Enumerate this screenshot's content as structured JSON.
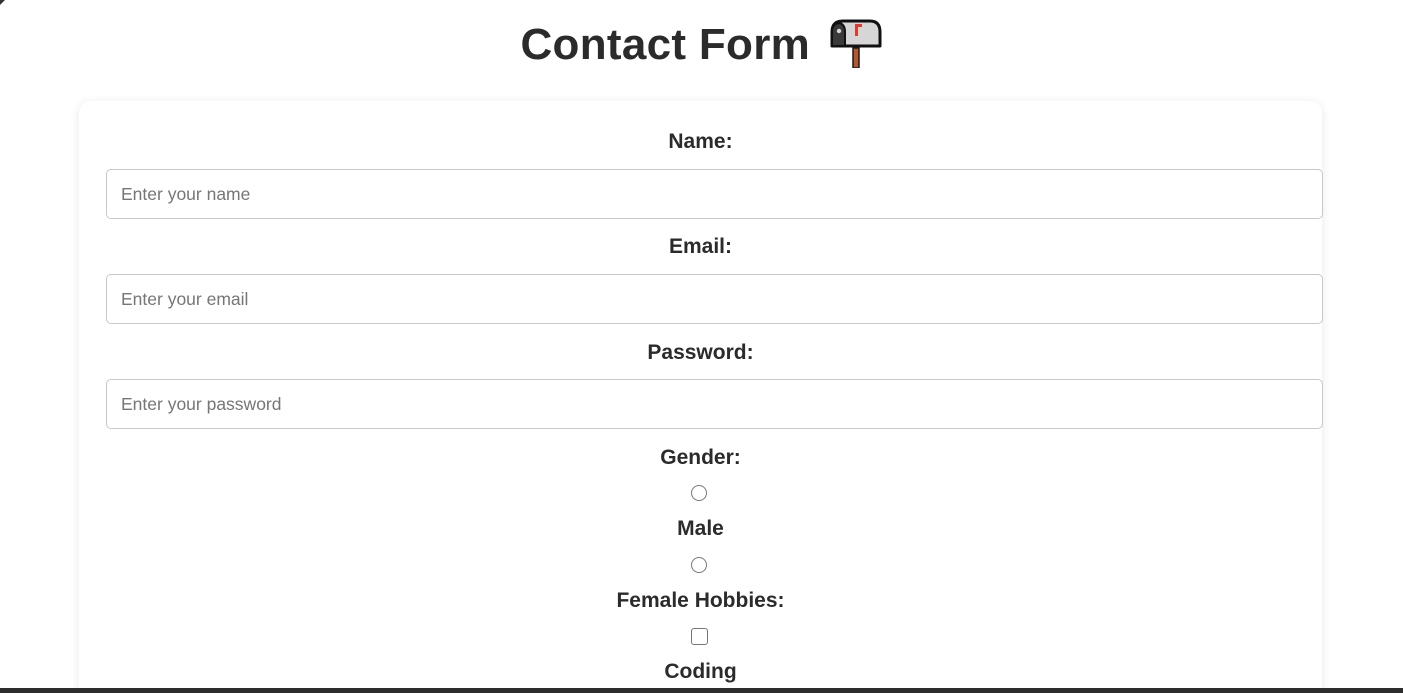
{
  "header": {
    "title": "Contact Form",
    "title_icon": "mailbox-icon"
  },
  "form": {
    "name": {
      "label": "Name:",
      "placeholder": "Enter your name",
      "value": ""
    },
    "email": {
      "label": "Email:",
      "placeholder": "Enter your email",
      "value": ""
    },
    "password": {
      "label": "Password:",
      "placeholder": "Enter your password",
      "value": ""
    },
    "gender": {
      "label": "Gender:",
      "options": [
        {
          "label": "Male",
          "checked": false
        },
        {
          "label": "Female",
          "checked": false
        }
      ]
    },
    "hobbies": {
      "label": "Hobbies:",
      "options": [
        {
          "label": "Coding",
          "checked": false
        }
      ]
    }
  },
  "colors": {
    "text": "#2b2b2b",
    "input_border": "#c8c8c8",
    "placeholder": "#767676",
    "card_background": "#ffffff",
    "mailbox_flag": "#e03a2f"
  }
}
